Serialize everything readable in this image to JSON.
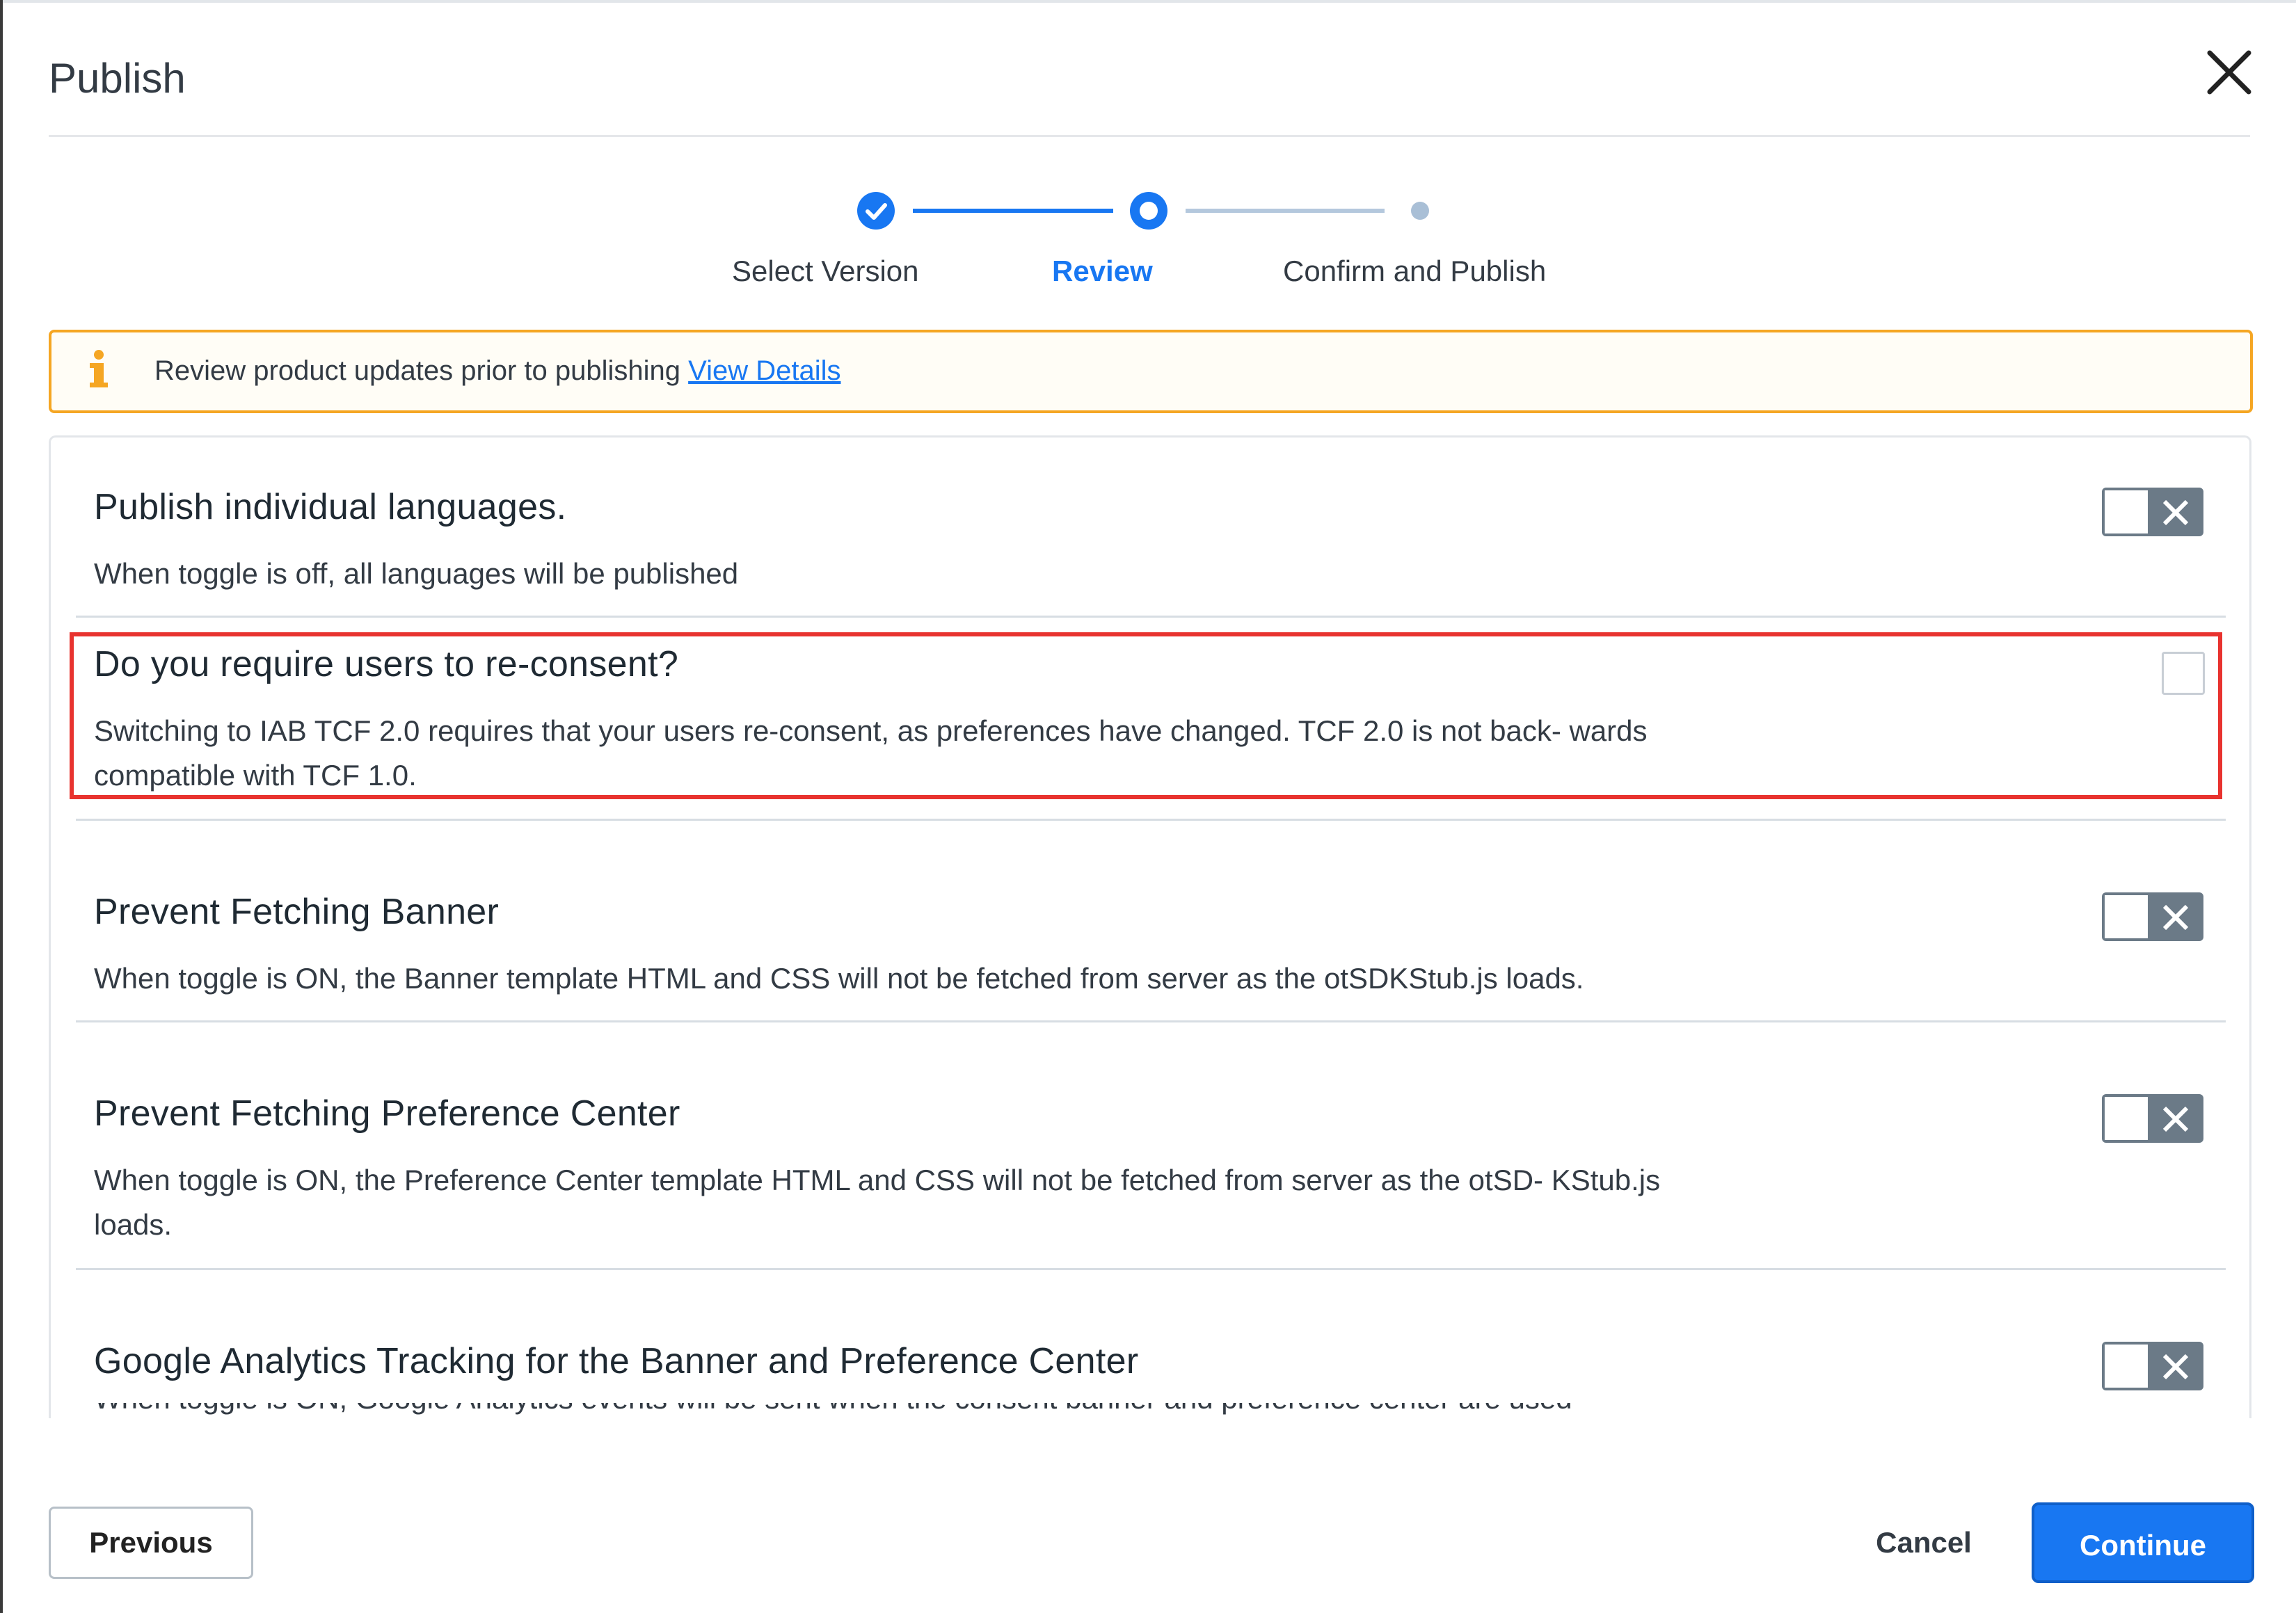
{
  "dialog": {
    "title": "Publish",
    "close_icon": "close-icon"
  },
  "stepper": {
    "steps": [
      {
        "label": "Select Version",
        "state": "complete"
      },
      {
        "label": "Review",
        "state": "current"
      },
      {
        "label": "Confirm and Publish",
        "state": "upcoming"
      }
    ]
  },
  "alert": {
    "icon": "info-icon",
    "text": "Review product updates prior to publishing",
    "link_text": "View Details"
  },
  "settings": [
    {
      "title": "Publish individual languages.",
      "description": "When toggle is off, all languages will be published",
      "control": "toggle",
      "on": false
    },
    {
      "title": "Do you require users to re-consent?",
      "description": "Switching to IAB TCF 2.0 requires that your users re-consent, as preferences have changed. TCF 2.0 is not back- wards compatible with TCF 1.0.",
      "control": "checkbox",
      "checked": false,
      "highlighted": true
    },
    {
      "title": "Prevent Fetching Banner",
      "description": "When toggle is ON, the Banner template HTML and CSS will not be fetched from server as the otSDKStub.js loads.",
      "control": "toggle",
      "on": false
    },
    {
      "title": "Prevent Fetching Preference Center",
      "description": "When toggle is ON, the Preference Center template HTML and CSS will not be fetched from server as the otSD- KStub.js loads.",
      "control": "toggle",
      "on": false
    },
    {
      "title": "Google Analytics Tracking for the Banner and Preference Center",
      "description": "When toggle is ON, Google Analytics events will be sent when the consent banner and preference center are used",
      "control": "toggle",
      "on": false
    }
  ],
  "footer": {
    "previous_label": "Previous",
    "cancel_label": "Cancel",
    "continue_label": "Continue"
  },
  "colors": {
    "accent": "#1877f2",
    "warning": "#f5a623",
    "highlight": "#e8332f"
  }
}
